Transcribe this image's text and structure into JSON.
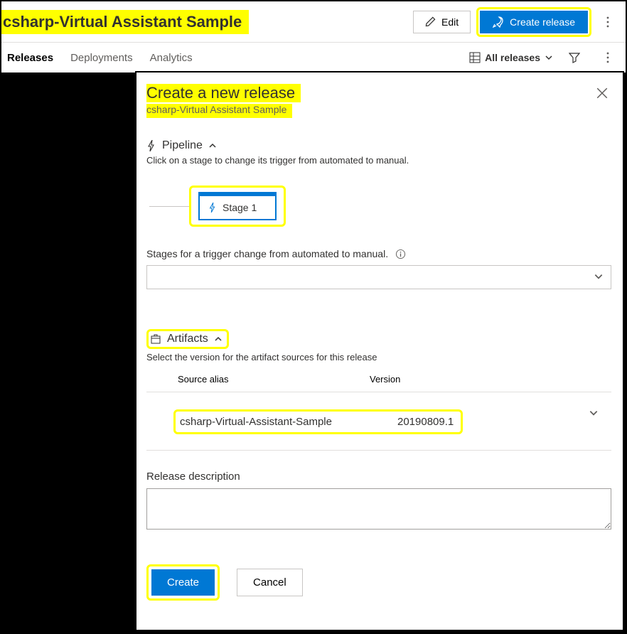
{
  "header": {
    "title": "csharp-Virtual Assistant Sample",
    "edit_label": "Edit",
    "create_release_label": "Create release"
  },
  "tabs": {
    "items": [
      "Releases",
      "Deployments",
      "Analytics"
    ],
    "active_index": 0,
    "all_releases_label": "All releases"
  },
  "panel": {
    "title": "Create a new release",
    "subtitle": "csharp-Virtual Assistant Sample",
    "pipeline": {
      "heading": "Pipeline",
      "helper": "Click on a stage to change its trigger from automated to manual.",
      "stage_label": "Stage 1",
      "trigger_label": "Stages for a trigger change from automated to manual."
    },
    "artifacts": {
      "heading": "Artifacts",
      "helper": "Select the version for the artifact sources for this release",
      "col_alias": "Source alias",
      "col_version": "Version",
      "rows": [
        {
          "alias": "csharp-Virtual-Assistant-Sample",
          "version": "20190809.1"
        }
      ]
    },
    "description_label": "Release description",
    "create_label": "Create",
    "cancel_label": "Cancel"
  }
}
